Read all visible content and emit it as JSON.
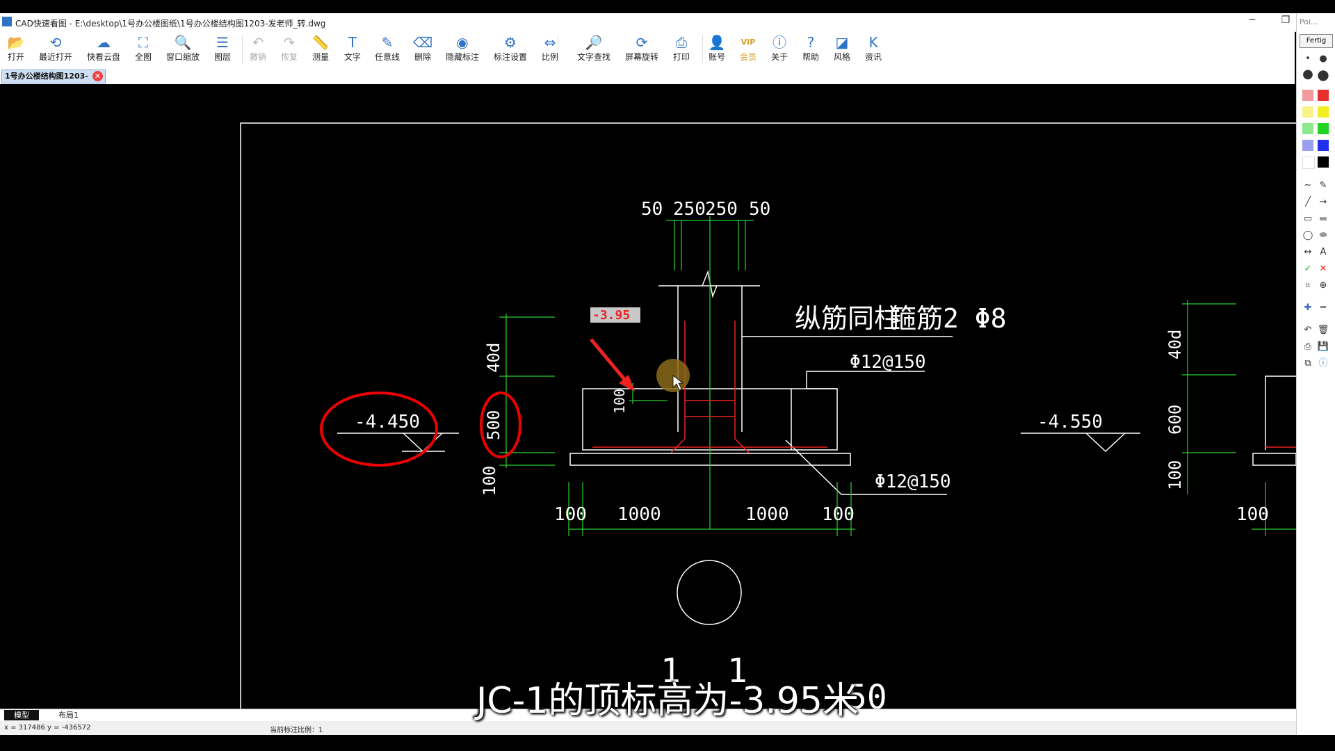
{
  "window": {
    "title": "CAD快速看图 - E:\\desktop\\1号办公楼图纸\\1号办公楼结构图1203-发老师_转.dwg",
    "minimize": "─",
    "restore": "❐"
  },
  "toolbar": [
    {
      "id": "open",
      "label": "打开",
      "icon": "folder-icon"
    },
    {
      "id": "recent",
      "label": "最近打开",
      "icon": "history-icon"
    },
    {
      "id": "cloud",
      "label": "快看云盘",
      "icon": "cloud-icon"
    },
    {
      "id": "fullview",
      "label": "全图",
      "icon": "fullscreen-icon"
    },
    {
      "id": "zoomwin",
      "label": "窗口缩放",
      "icon": "zoom-window-icon"
    },
    {
      "id": "layers",
      "label": "图层",
      "icon": "layers-icon"
    },
    {
      "id": "undo",
      "label": "撤销",
      "icon": "undo-icon",
      "disabled": true
    },
    {
      "id": "redo",
      "label": "恢复",
      "icon": "redo-icon",
      "disabled": true
    },
    {
      "id": "measure",
      "label": "测量",
      "icon": "ruler-icon"
    },
    {
      "id": "text",
      "label": "文字",
      "icon": "text-icon"
    },
    {
      "id": "freeline",
      "label": "任意线",
      "icon": "pen-icon"
    },
    {
      "id": "erase",
      "label": "删除",
      "icon": "eraser-icon"
    },
    {
      "id": "hidemark",
      "label": "隐藏标注",
      "icon": "eye-icon"
    },
    {
      "id": "marksettings",
      "label": "标注设置",
      "icon": "mark-settings-icon"
    },
    {
      "id": "scale",
      "label": "比例",
      "icon": "scale-icon"
    },
    {
      "id": "findtext",
      "label": "文字查找",
      "icon": "find-text-icon"
    },
    {
      "id": "rotate",
      "label": "屏幕旋转",
      "icon": "rotate-icon"
    },
    {
      "id": "print",
      "label": "打印",
      "icon": "printer-icon"
    },
    {
      "id": "account",
      "label": "账号",
      "icon": "user-icon"
    },
    {
      "id": "vip",
      "label": "会员",
      "icon": "vip-icon",
      "vip": true,
      "badge": "VIP"
    },
    {
      "id": "about",
      "label": "关于",
      "icon": "info-icon"
    },
    {
      "id": "help",
      "label": "帮助",
      "icon": "help-icon"
    },
    {
      "id": "style",
      "label": "风格",
      "icon": "style-icon"
    },
    {
      "id": "news",
      "label": "资讯",
      "icon": "news-icon"
    }
  ],
  "doc_tab": {
    "label": "1号办公楼结构图1203-",
    "close": "✕"
  },
  "side_panel": {
    "header": "Poi...",
    "button": "Fertig",
    "colors": [
      "#e63030",
      "#f2ee22",
      "#22d322",
      "#2230ee",
      "#ffffff",
      "#000000"
    ]
  },
  "drawing": {
    "top_dims": [
      "50",
      "250",
      "250",
      "50"
    ],
    "note_main": "纵筋同柱",
    "note_stirrup": "箍筋2 Φ8",
    "rebar_top": "Φ12@150",
    "rebar_bottom": "Φ12@150",
    "dim_40d_left": "40d",
    "dim_500": "500",
    "dim_100_left": "100",
    "dim_100_inner": "100",
    "elev_left": "-4.450",
    "elev_right": "-4.550",
    "elev_highlight": "-3.95",
    "bottom_dims": [
      "100",
      "1000",
      "1000",
      "100"
    ],
    "right_40d": "40d",
    "right_600": "600",
    "right_100": "100",
    "right_bottom_100": "100",
    "section_label": "1",
    "section_label2": "1",
    "section_label3": "50"
  },
  "bottom_tabs": [
    "模型",
    "布局1"
  ],
  "status": {
    "coords": "x = 317486  y = -436572",
    "scale": "当前标注比例：1"
  },
  "caption": "JC-1的顶标高为-3.95米"
}
